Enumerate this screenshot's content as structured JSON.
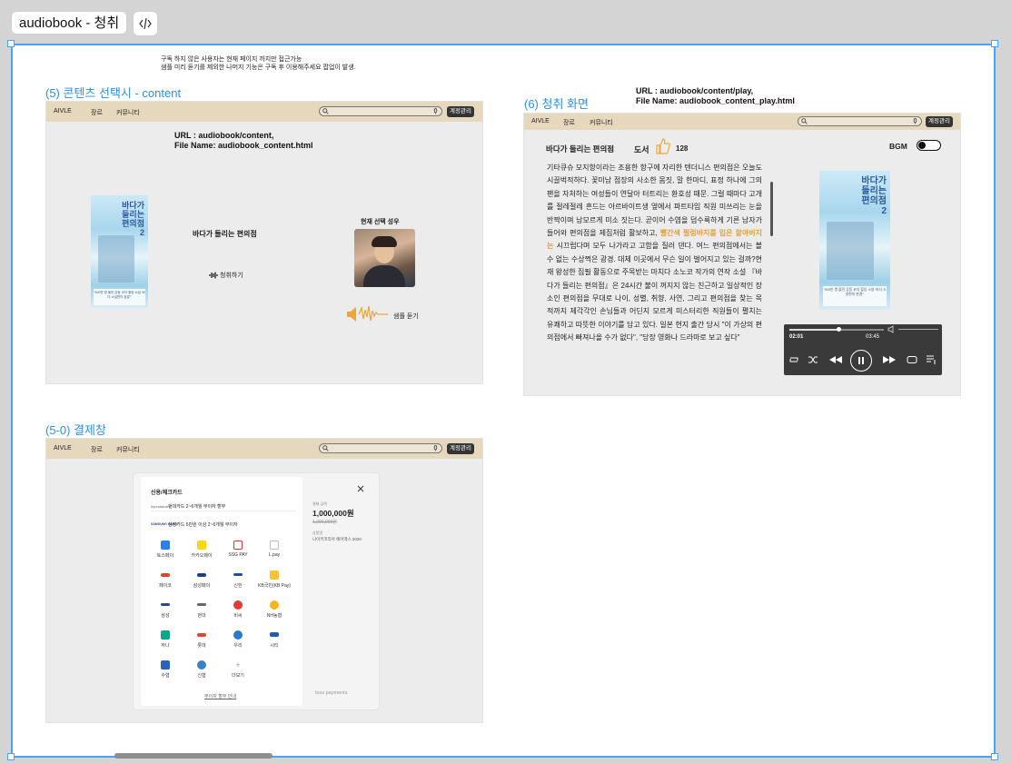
{
  "window": {
    "tab_title": "audiobook - 청취"
  },
  "notes": {
    "top_line1": "구독 하지 않은 사용자는 현재 페이지 까지만 접근가능",
    "top_line2": "샘플 미리 듣기를 제외한 나머지 기능은 구독 후 이용해주세요 팝업이 발생."
  },
  "content_section": {
    "title": "(5) 콘텐츠 선택시 - content",
    "url_line1": "URL : audiobook/content,",
    "url_line2": "File Name: audiobook_content.html",
    "book_title": "바다가 들리는 편의점",
    "listen_label": "청취하기",
    "voice_label": "현재 선택 성우",
    "sample_label": "샘플 듣기",
    "cover_title": [
      "바다가",
      "들리는",
      "편의점",
      "2"
    ],
    "cover_caption": "\"500만 명 울린 감동 코지 힐링 소설 '바다 소설편의 완결'\""
  },
  "nav": {
    "brand": "AIVLE",
    "genre": "장르",
    "community": "커뮤니티",
    "account": "계정관리"
  },
  "play_section": {
    "title": "(6) 청취 화면",
    "url_line1": "URL : audiobook/content/play,",
    "url_line2": "File Name: audiobook_content_play.html",
    "book_title": "바다가 들리는 편의점",
    "category": "도서",
    "likes": "128",
    "bgm_label": "BGM",
    "text_part1": "기타큐슈 모지항이라는 조용한 항구에 자리한 텐더니스 편의점은 오늘도 시끌벅적하다. 꽃미남 점장의 사소한 몸짓, 말 한마디, 표정 하나에 그의 팬을 자처하는 여성들이 연달아 터트리는 환호성 때문. 그럴 때마다 고개를 절레절레 흔드는 아르바이트생 옆에서 파트타임 직원 미쓰리는 눈을 반짝이며 남모르게 미소 짓는다. 곧이어 수염을 덥수룩하게 기른 남자가 들어와 편의점을 제집처럼 활보하고,",
    "text_highlight": "빨간색 펄렁바지를 입은 할아버지는",
    "text_part2": "시끄럽다며 모두 나가라고 고함을 질러 댄다. 여느 편의점에서는 볼 수 없는 수상쩍은 광경. 대체 이곳에서 무슨 일이 벌어지고 있는 걸까?현재 왕성한 집필 활동으로 주목받는 마치다 소노코 작가의 연작 소설 『바다가 들리는 편의점』은 24시간 불이 꺼지지 않는 친근하고 일상적인 장소인 편의점을 무대로 나이, 성별, 취향, 사연, 그리고 편의점을 찾는 목적까지 제각각인 손님들과 어딘지 모르게 미스터리한 직원들이 펼치는 유쾌하고 따뜻한 이야기를 담고 있다. 일본 현지 출간 당시 \"이 가상의 편의점에서 빠져나올 수가 없다\", \"당장 영화나 드라마로 보고 싶다\"",
    "time_current": "02:01",
    "time_total": "03:45"
  },
  "payment_section": {
    "title": "(5-0) 결제창",
    "modal_title": "신용/체크카드",
    "option1_brand": "hyundaicard",
    "option1_text": "현대카드   2~6개월 무이자 할부",
    "option2_brand": "SAMSUNG CARD",
    "option2_text": "삼성카드   5만원 이상 2~6개월 무이자",
    "amount_label": "결제 금액",
    "amount": "1,000,000원",
    "amount_original": "1,200,000원",
    "product_label": "상품명",
    "product_name": "나이키코리아 에어맥스 2020",
    "methods": [
      "토스페이",
      "카카오페이",
      "SSG PAY",
      "L.pay",
      "페이코",
      "삼성페이",
      "신한",
      "KB국민(KB Pay)",
      "삼성",
      "현대",
      "비씨",
      "NH농협",
      "하나",
      "롯데",
      "우리",
      "시티",
      "수협",
      "신협",
      "더보기"
    ],
    "installment_link": "무이자 할부 안내",
    "provider": "toss payments"
  },
  "colors": {
    "canvas_border": "#4aa3f0",
    "section_title": "#2d8fe0",
    "nav_bg": "#e6d8bd",
    "highlight": "#e2a23a"
  }
}
